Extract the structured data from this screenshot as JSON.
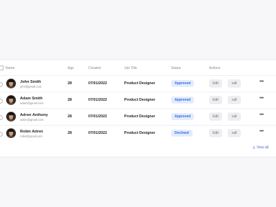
{
  "table": {
    "headers": {
      "name": "Name",
      "age": "Age",
      "created": "Created",
      "job_title": "Job Title",
      "status": "Status",
      "actions": "Actions"
    },
    "rows": [
      {
        "name": "John Smith",
        "email": "john@gmail.com",
        "age": "28",
        "created": "07/01/2022",
        "job_title": "Product Designer",
        "status": "Approved",
        "edit": "Edit",
        "call": "call",
        "more": "•••"
      },
      {
        "name": "Adam Smith",
        "email": "adam@gmail.com",
        "age": "28",
        "created": "07/01/2022",
        "job_title": "Product Designer",
        "status": "Approved",
        "edit": "Edit",
        "call": "call",
        "more": "•••"
      },
      {
        "name": "Adron Anthony",
        "email": "adron@gmail.com",
        "age": "28",
        "created": "07/01/2022",
        "job_title": "Product Designer",
        "status": "Approved",
        "edit": "Edit",
        "call": "call",
        "more": "•••"
      },
      {
        "name": "Robin Adren",
        "email": "robin@gmail.com",
        "age": "28",
        "created": "07/01/2022",
        "job_title": "Product Designer",
        "status": "Declined",
        "edit": "Edit",
        "call": "call",
        "more": "•••"
      }
    ],
    "view_all": "View all"
  },
  "colors": {
    "accent": "#2f6ee0",
    "badge_bg": "#e3ecfd",
    "button_bg": "#eeeef1",
    "background": "#f7f7f9"
  }
}
